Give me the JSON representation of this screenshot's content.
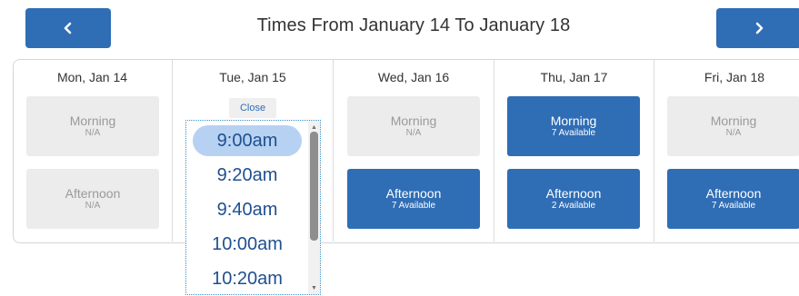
{
  "header": {
    "title": "Times From January 14 To January 18",
    "prev_icon": "chevron-left-icon",
    "next_icon": "chevron-right-icon"
  },
  "days": [
    {
      "label": "Mon, Jan 14",
      "morning": {
        "name": "Morning",
        "status": "N/A"
      },
      "afternoon": {
        "name": "Afternoon",
        "status": "N/A"
      }
    },
    {
      "label": "Tue, Jan 15",
      "close_label": "Close",
      "times": [
        "9:00am",
        "9:20am",
        "9:40am",
        "10:00am",
        "10:20am"
      ],
      "selected_time": "9:00am"
    },
    {
      "label": "Wed, Jan 16",
      "morning": {
        "name": "Morning",
        "status": "N/A"
      },
      "afternoon": {
        "name": "Afternoon",
        "status": "7 Available"
      }
    },
    {
      "label": "Thu, Jan 17",
      "morning": {
        "name": "Morning",
        "status": "7 Available"
      },
      "afternoon": {
        "name": "Afternoon",
        "status": "2 Available"
      }
    },
    {
      "label": "Fri, Jan 18",
      "morning": {
        "name": "Morning",
        "status": "N/A"
      },
      "afternoon": {
        "name": "Afternoon",
        "status": "7 Available"
      }
    }
  ],
  "colors": {
    "accent": "#2f6db5",
    "unavailable_bg": "#ececec",
    "selected_time_bg": "#b7d1f3"
  }
}
